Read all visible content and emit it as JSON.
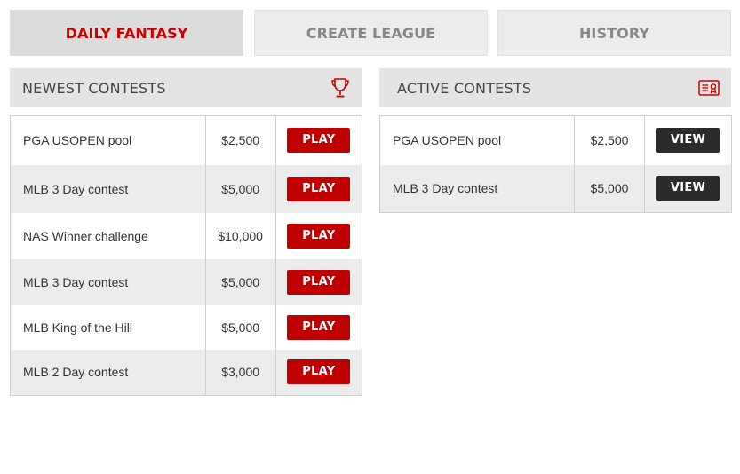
{
  "tabs": [
    {
      "label": "DAILY FANTASY",
      "active": true
    },
    {
      "label": "CREATE LEAGUE",
      "active": false
    },
    {
      "label": "HISTORY",
      "active": false
    }
  ],
  "newest": {
    "title": "NEWEST CONTESTS",
    "icon": "trophy-icon",
    "rows": [
      {
        "name": "PGA USOPEN pool",
        "prize": "$2,500",
        "action": "PLAY"
      },
      {
        "name": "MLB 3 Day contest",
        "prize": "$5,000",
        "action": "PLAY"
      },
      {
        "name": "NAS Winner challenge",
        "prize": "$10,000",
        "action": "PLAY"
      },
      {
        "name": "MLB 3 Day contest",
        "prize": "$5,000",
        "action": "PLAY"
      },
      {
        "name": "MLB King of the Hill",
        "prize": "$5,000",
        "action": "PLAY"
      },
      {
        "name": "MLB 2 Day contest",
        "prize": "$3,000",
        "action": "PLAY"
      }
    ]
  },
  "active": {
    "title": "ACTIVE CONTESTS",
    "icon": "ticket-icon",
    "rows": [
      {
        "name": "PGA USOPEN pool",
        "prize": "$2,500",
        "action": "VIEW"
      },
      {
        "name": "MLB 3 Day contest",
        "prize": "$5,000",
        "action": "VIEW"
      }
    ]
  },
  "colors": {
    "accent": "#cc0000",
    "play_button": "#c00000",
    "view_button": "#2b2b2b"
  }
}
